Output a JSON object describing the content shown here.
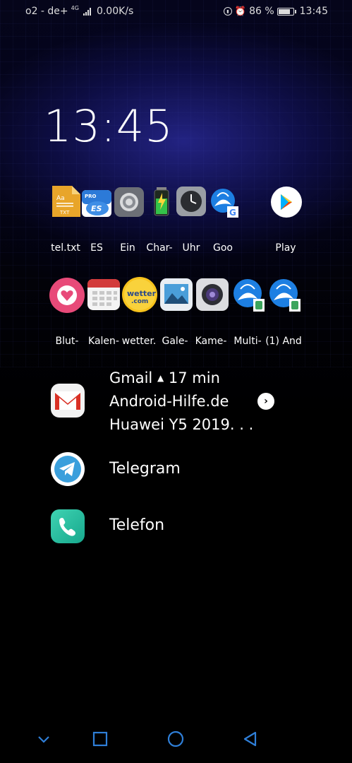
{
  "status_bar": {
    "carrier": "o2 - de+",
    "net_type": "4G",
    "speed": "0.00K/s",
    "battery": "86 %",
    "battery_level": 0.86,
    "time": "13:45"
  },
  "clock": "13:45",
  "row1": [
    {
      "label": "tel.txt",
      "icon": "txt-file-icon"
    },
    {
      "label": "ES",
      "icon": "es-file-explorer-icon"
    },
    {
      "label": "Ein",
      "icon": "settings-icon"
    },
    {
      "label": "Char-",
      "icon": "battery-charge-icon"
    },
    {
      "label": "Uhr",
      "icon": "clock-icon"
    },
    {
      "label": "Goo",
      "icon": "google-browser-icon"
    },
    {
      "label": "Play",
      "icon": "play-store-icon"
    }
  ],
  "row2": [
    {
      "label": "Blut-",
      "icon": "heart-icon"
    },
    {
      "label": "Kalen-",
      "icon": "calendar-icon"
    },
    {
      "label": "wetter.",
      "icon": "wetter-icon"
    },
    {
      "label": "Gale-",
      "icon": "gallery-icon"
    },
    {
      "label": "Kame-",
      "icon": "camera-icon"
    },
    {
      "label": "Multi-",
      "icon": "multi-browser-icon"
    },
    {
      "label": "(1) And",
      "icon": "android-browser-icon"
    }
  ],
  "wetter_text": "wetter\n.com",
  "gmail": {
    "app": "Gmail",
    "time": "17 min",
    "sender": "Android-Hilfe.de",
    "subject": "Huawei Y5 2019. . ."
  },
  "telegram": {
    "label": "Telegram"
  },
  "telefon": {
    "label": "Telefon"
  },
  "colors": {
    "accent_blue": "#2f7fd8",
    "nav_blue": "#2f7fd8"
  }
}
